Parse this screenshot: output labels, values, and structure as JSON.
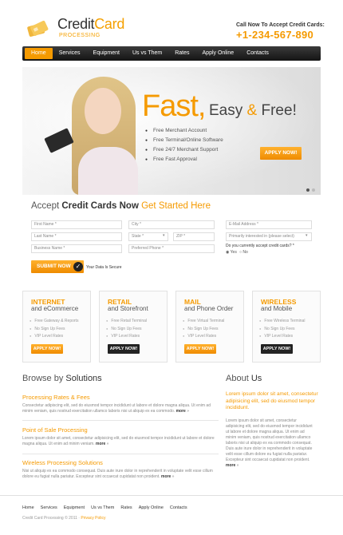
{
  "header": {
    "logo_main": "Credit",
    "logo_accent": "Card",
    "logo_sub": "PROCESSING",
    "call_label": "Call Now To Accept Credit Cards:",
    "phone": "+1-234-567-890"
  },
  "nav": {
    "items": [
      "Home",
      "Services",
      "Equipment",
      "Us vs Them",
      "Rates",
      "Apply Online",
      "Contacts"
    ],
    "active_index": 0
  },
  "hero": {
    "headline_big": "Fast,",
    "headline_word1": "Easy",
    "headline_amp": "&",
    "headline_word2": "Free!",
    "features": [
      "Free Merchant Account",
      "Free Terminal/Online Software",
      "Free 24/7 Merchant Support",
      "Free Fast Approval"
    ],
    "apply_label": "APPLY NOW!",
    "slide_count": 2,
    "active_slide": 0
  },
  "form": {
    "title_part1": "Accept",
    "title_part2": "Credit Cards",
    "title_part3": "Now",
    "title_part4": "Get Started Here",
    "first_name": "First Name *",
    "city": "City *",
    "email": "E-Mail Address *",
    "last_name": "Last Name *",
    "state": "State *",
    "zip": "ZIP *",
    "interest_select": "Primarily interested in (please select)",
    "business_name": "Business Name *",
    "preferred_phone": "Preferred Phone *",
    "question": "Do you currently accept credit cards? *",
    "yes_label": "Yes",
    "no_label": "No",
    "submit_label": "SUBMIT NOW",
    "secure_label": "Your Data Is Secure"
  },
  "boxes": [
    {
      "title": "INTERNET",
      "subtitle": "and eCommerce",
      "items": [
        "Free Gateway & Reports",
        "No Sign Up Fees",
        "VIP Level Rates"
      ],
      "button": "APPLY NOW!",
      "button_style": "orange"
    },
    {
      "title": "RETAIL",
      "subtitle": "and Storefront",
      "items": [
        "Free Retail Terminal",
        "No Sign Up Fees",
        "VIP Level Rates"
      ],
      "button": "APPLY NOW!",
      "button_style": "dark"
    },
    {
      "title": "MAIL",
      "subtitle": "and Phone Order",
      "items": [
        "Free Virtual Terminal",
        "No Sign Up Fees",
        "VIP Level Rates"
      ],
      "button": "APPLY NOW!",
      "button_style": "orange"
    },
    {
      "title": "WIRELESS",
      "subtitle": "and Mobile",
      "items": [
        "Free Wireless Terminal",
        "No Sign Up Fees",
        "VIP Level Rates"
      ],
      "button": "APPLY NOW!",
      "button_style": "dark"
    }
  ],
  "solutions": {
    "heading1": "Browse by",
    "heading2": "Solutions",
    "items": [
      {
        "title": "Processing Rates & Fees",
        "text": "Consectetur adipiscing elit, sed do eiusmod tempor incididunt ut labore et dolore magna aliqua. Ut enim ad minim veniam, quis nostrud exercitation ullamco laboris nisi ut aliquip ex ea commodo.",
        "more": "more"
      },
      {
        "title": "Point of Sale Processing",
        "text": "Lorem ipsum dolor sit amet, consectetur adipisicing elit, sed do eiusmod tempor incididunt ut labore et dolore magna aliqua. Ut enim ad minim veniam.",
        "more": "more"
      },
      {
        "title": "Wireless Processing Solutions",
        "text": "Nisi ut aliquip ex ea commodo consequat. Duis aute irure dolor in reprehenderit in voluptate velit esse cillum dolore eu fugiat nulla pariatur. Excepteur sint occaecat cupidatat non proident.",
        "more": "more"
      }
    ]
  },
  "about": {
    "heading1": "About",
    "heading2": "Us",
    "lead": "Lorem ipsum dolor sit amet, consectetur adipisicing elit, sed do eiusmod tempor incididunt.",
    "text": "Lorem ipsum dolor sit amet, consectetur adipisicing elit, sed do eiusmod tempor incididunt ut labore et dolore magna aliqua. Ut enim ad minim veniam, quis nostrud exercitation ullamco laboris nisi ut aliquip ex ea commodo consequat. Duis aute irure dolor in reprehenderit in voluptate velit esse cillum dolore eu fugiat nulla pariatur. Excepteur sint occaecat cupidatat non proident.",
    "more": "more"
  },
  "footer": {
    "links": [
      "Home",
      "Services",
      "Equipment",
      "Us vs Them",
      "Rates",
      "Apply Online",
      "Contacts"
    ],
    "copyright": "Credit Card Processing © 2011",
    "privacy": "Privacy Policy"
  },
  "colors": {
    "accent": "#f59a00",
    "nav_bg": "#1e1e1e",
    "dark_button": "#222222"
  }
}
